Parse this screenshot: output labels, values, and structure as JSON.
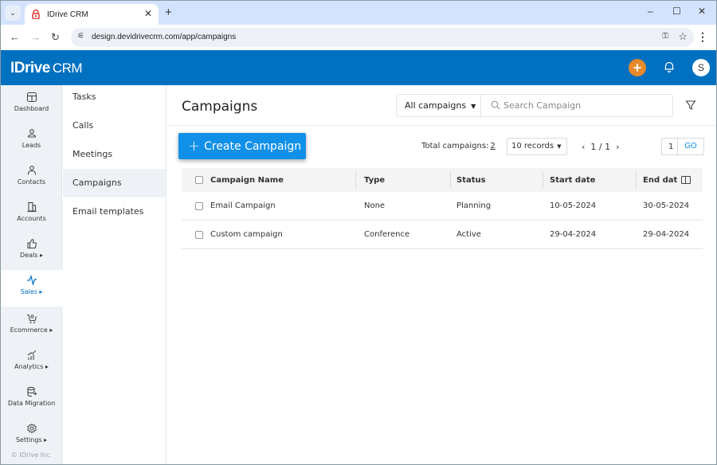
{
  "browser": {
    "tab_title": "IDrive CRM",
    "url": "design.devidrivecrm.com/app/campaigns",
    "window_controls": {
      "minimize": "–",
      "maximize": "☐",
      "close": "✕"
    }
  },
  "header": {
    "logo_brand": "IDrive",
    "logo_product": "CRM",
    "avatar_initial": "S",
    "add_icon": "+",
    "colors": {
      "header_bg": "#0070c0",
      "add_button": "#e8892b",
      "primary": "#1190e8"
    }
  },
  "icon_nav": {
    "items": [
      {
        "label": "Dashboard",
        "icon": "dashboard-icon",
        "active": false
      },
      {
        "label": "Leads",
        "icon": "leads-icon",
        "active": false
      },
      {
        "label": "Contacts",
        "icon": "contacts-icon",
        "active": false
      },
      {
        "label": "Accounts",
        "icon": "accounts-icon",
        "active": false
      },
      {
        "label": "Deals ▸",
        "icon": "deals-icon",
        "active": false
      },
      {
        "label": "Sales ▸",
        "icon": "sales-icon",
        "active": true
      },
      {
        "label": "Ecommerce ▸",
        "icon": "ecommerce-icon",
        "active": false
      },
      {
        "label": "Analytics ▸",
        "icon": "analytics-icon",
        "active": false
      },
      {
        "label": "Data Migration",
        "icon": "data-migration-icon",
        "active": false
      },
      {
        "label": "Settings ▸",
        "icon": "settings-icon",
        "active": false
      }
    ],
    "copyright": "© IDrive Inc."
  },
  "sub_nav": {
    "items": [
      {
        "label": "Tasks",
        "active": false
      },
      {
        "label": "Calls",
        "active": false
      },
      {
        "label": "Meetings",
        "active": false
      },
      {
        "label": "Campaigns",
        "active": true
      },
      {
        "label": "Email templates",
        "active": false
      }
    ]
  },
  "main": {
    "title": "Campaigns",
    "filter_select": "All campaigns",
    "search_placeholder": "Search Campaign",
    "create_button": "Create Campaign",
    "total_label": "Total campaigns:",
    "total_count": "2",
    "records_select": "10 records",
    "pager": {
      "prev": "‹",
      "current": "1 / 1",
      "next": "›"
    },
    "page_input_value": "1",
    "go_label": "GO"
  },
  "table": {
    "columns": [
      "Campaign Name",
      "Type",
      "Status",
      "Start date",
      "End dat"
    ],
    "rows": [
      {
        "name": "Email Campaign",
        "type": "None",
        "status": "Planning",
        "start": "10-05-2024",
        "end": "30-05-2024"
      },
      {
        "name": "Custom campaign",
        "type": "Conference",
        "status": "Active",
        "start": "29-04-2024",
        "end": "29-04-2024"
      }
    ]
  }
}
